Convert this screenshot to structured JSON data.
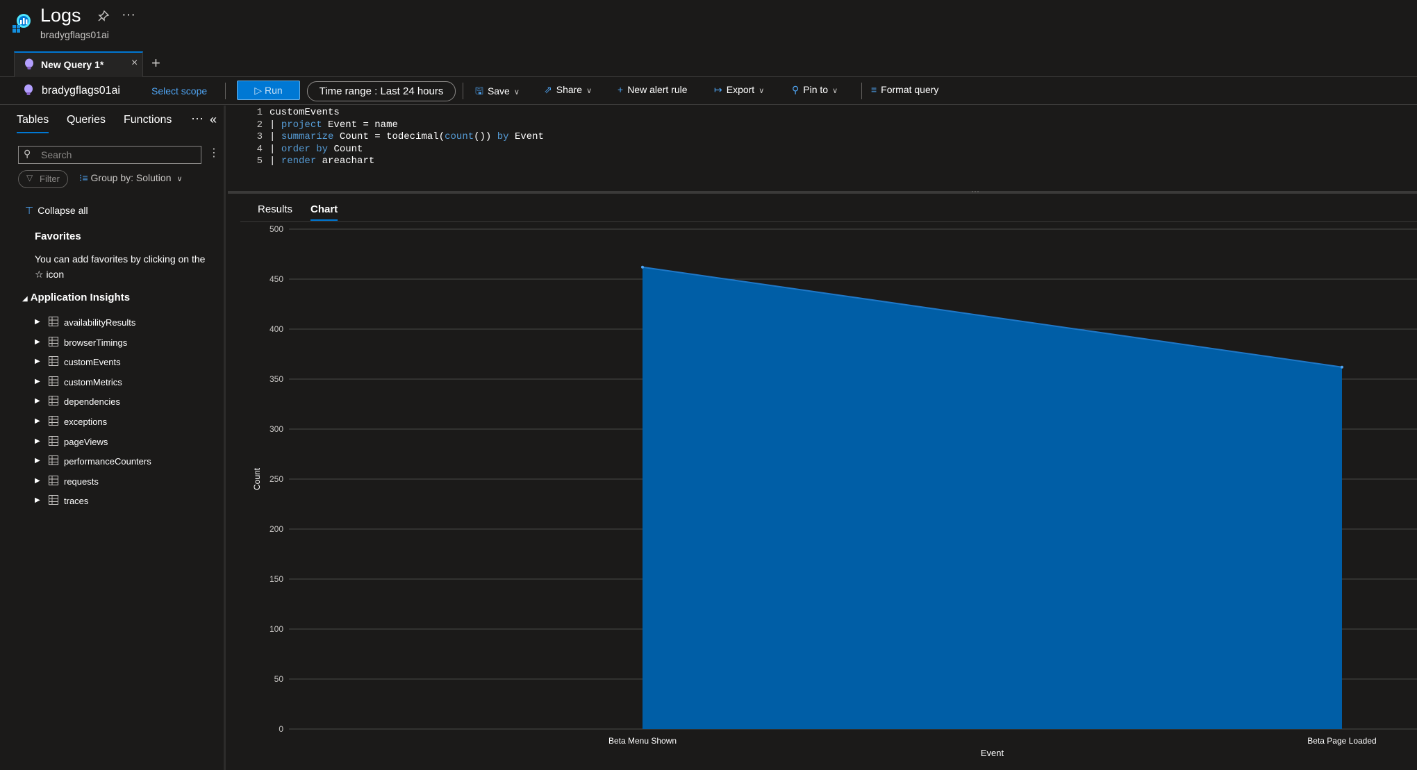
{
  "header": {
    "title": "Logs",
    "subtitle": "bradygflags01ai"
  },
  "tabs": {
    "query_tab_label": "New Query 1*",
    "close": "×",
    "add": "+"
  },
  "toolbar": {
    "scope_name": "bradygflags01ai",
    "select_scope": "Select scope",
    "run": "Run",
    "time_range": "Time range :  Last 24 hours",
    "save": "Save",
    "share": "Share",
    "new_alert_rule": "New alert rule",
    "export": "Export",
    "pin_to": "Pin to",
    "format_query": "Format query"
  },
  "sidebar": {
    "tabs": [
      "Tables",
      "Queries",
      "Functions"
    ],
    "search_placeholder": "Search",
    "filter": "Filter",
    "group_by": "Group by: Solution",
    "collapse_all": "Collapse all",
    "favorites_title": "Favorites",
    "favorites_desc": "You can add favorites by clicking on the ☆ icon",
    "section_title": "Application Insights",
    "tables": [
      "availabilityResults",
      "browserTimings",
      "customEvents",
      "customMetrics",
      "dependencies",
      "exceptions",
      "pageViews",
      "performanceCounters",
      "requests",
      "traces"
    ]
  },
  "editor": {
    "lines": [
      {
        "n": "1",
        "text": "customEvents"
      },
      {
        "n": "2",
        "text": "| project Event = name"
      },
      {
        "n": "3",
        "text": "| summarize Count = todecimal(count()) by Event"
      },
      {
        "n": "4",
        "text": "| order by Count"
      },
      {
        "n": "5",
        "text": "| render areachart"
      }
    ]
  },
  "results": {
    "tabs": [
      "Results",
      "Chart"
    ],
    "active": "Chart"
  },
  "colors": {
    "accent": "#0078d4",
    "area_fill": "#005ea6",
    "area_stroke": "#1f78c8"
  },
  "chart_data": {
    "type": "area",
    "categories": [
      "Beta Menu Shown",
      "Beta Page Loaded"
    ],
    "series": [
      {
        "values": [
          462,
          362
        ]
      }
    ],
    "xlabel": "Event",
    "ylabel": "Count",
    "ylim": [
      0,
      500
    ],
    "yticks": [
      0,
      50,
      100,
      150,
      200,
      250,
      300,
      350,
      400,
      450,
      500
    ],
    "grid": true
  }
}
